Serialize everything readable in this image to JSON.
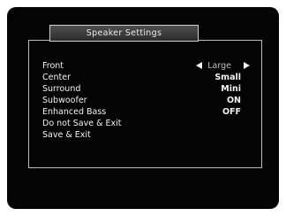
{
  "dialog": {
    "title": "Speaker Settings"
  },
  "menu": {
    "items": [
      {
        "label": "Front",
        "value": "Large"
      },
      {
        "label": "Center",
        "value": "Small"
      },
      {
        "label": "Surround",
        "value": "Mini"
      },
      {
        "label": "Subwoofer",
        "value": "ON"
      },
      {
        "label": "Enhanced Bass",
        "value": "OFF"
      },
      {
        "label": "Do not Save & Exit"
      },
      {
        "label": "Save & Exit"
      }
    ]
  },
  "icons": {
    "left": "triangle-left-icon",
    "right": "triangle-right-icon"
  }
}
